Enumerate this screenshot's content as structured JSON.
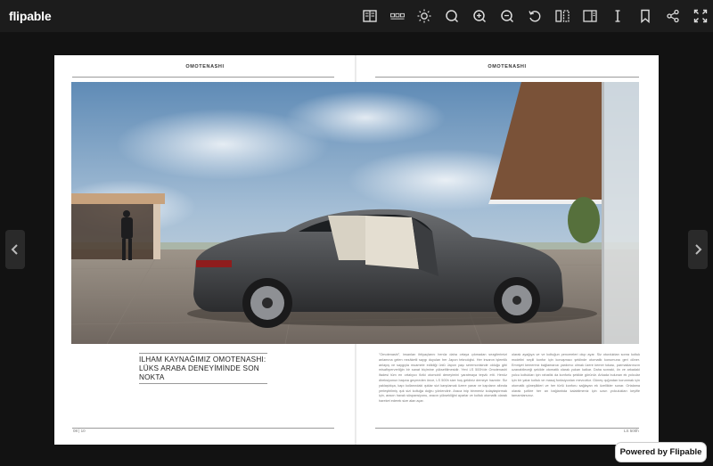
{
  "app": {
    "logo": "flipable"
  },
  "toolbar": {
    "buttons": [
      {
        "name": "table-of-contents-icon"
      },
      {
        "name": "thumbnails-icon"
      },
      {
        "name": "brightness-icon"
      },
      {
        "name": "search-icon"
      },
      {
        "name": "zoom-in-icon"
      },
      {
        "name": "zoom-out-icon"
      },
      {
        "name": "rotate-icon"
      },
      {
        "name": "double-page-icon"
      },
      {
        "name": "sidebar-icon"
      },
      {
        "name": "text-icon"
      },
      {
        "name": "bookmark-icon"
      },
      {
        "name": "share-icon"
      },
      {
        "name": "fullscreen-icon"
      }
    ]
  },
  "spread": {
    "left_page": {
      "header": "OMOTENASHI",
      "headline": "ILHAM KAYNAĞIMIZ OMOTENASHI: LÜKS ARABA DENEYİMİNDE SON NOKTA",
      "folio": "08 | 10"
    },
    "right_page": {
      "header": "OMOTENASHI",
      "column1": "\"Omotenashi\", insanları ihtiyaçlarını henüz daha ortaya çıkmadan sezgilerimizi anlamına gelen nezâketli saygı duyuları her Japon teknolojisi. Her insanın işlemlik anlayış ve saygıyla muamele edildiği ünlü Japon yaşı seremonisinde olduğu gibi misafirperverliğin bir sanat biçimine yükseltilmesidir. Yeni LS 500h'de Omotenashi ifadesi tüm en ortalıyıcı fiziki otomobil deneyimini yaratmaya teşvik etti.\n\nHenüz direksiyonun başına geçmeden önce, LS 500h size hoş geldiniz demeye hazırdır. Siz yaklaştıkça, kapı kollarındaki ışıklar sizi karşılamak üzere yanar ve kapıların altında yerleştirilmiş ışık sizi koltuğa doğru yönlendirir. Araca inip binmeniz kolaylaştırmak için, aracın havalı süspansiyonu, aracın yüksekliğini ayarlar ve koltuk otomatik olarak hareket ederek size alan açar.",
      "column2": "olarak ayağıya ve ve koltuğun pencereleri olup ayar. Siz oturduktan sonra koltuk modelini seçili konfor için konuşmacı şeklinde otomatik konumuna geri döner. Emniyet kemeriniz bağlamanızı yardımcı olmak üzere kemer tokası, parmaklarınızın uzanabileceği şekilde otomatik olarak yukarı kalkar.\n\nDaha sonraki, ön ve arkadaki yolcu koltukları için rahatlık da konforlu şekilde görünür. Arkada bulunan ek yolcular için bir yatar koltuk ve masaj fonksiyonları mevcuttur. Güneş ışığından korunmak için otomatik güneşlikleri ve her türlü konforu sağlayan ek özellikler sunar. Ortalama olarak şoföre her an bağlantıda kalabilmeniz için uzun yolculukları keyifle tamamlarsınız.",
      "folio": "LS 500h"
    }
  },
  "footer": {
    "powered_by": "Powered by Flipable"
  },
  "colors": {
    "topbar": "#1c1c1c",
    "stage": "#121212",
    "page": "#ffffff"
  }
}
